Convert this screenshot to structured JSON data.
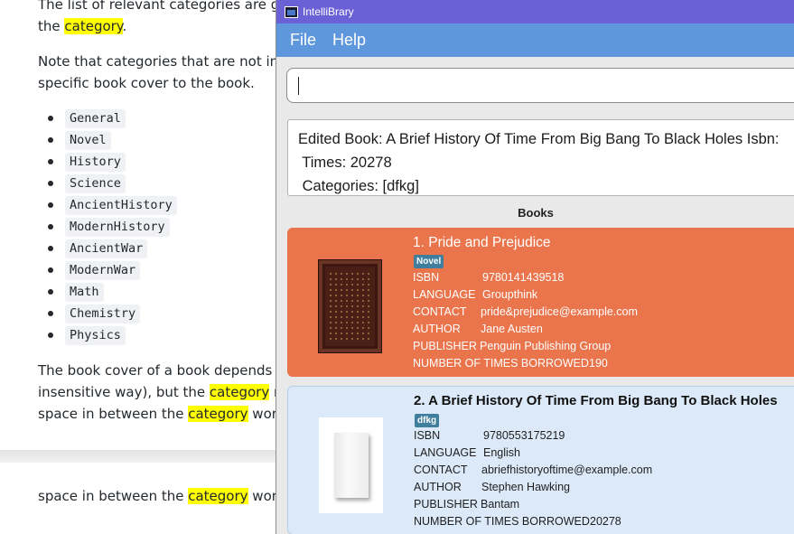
{
  "document": {
    "line1": {
      "before": "The list of relevant categories are give",
      "highlight": "",
      "after": ""
    },
    "line2": {
      "before": "the ",
      "highlight": "category",
      "after": "."
    },
    "note_line1": "Note that categories that are not in th",
    "note_line2": "specific book cover to the book.",
    "categories": [
      "General",
      "Novel",
      "History",
      "Science",
      "AncientHistory",
      "ModernHistory",
      "AncientWar",
      "ModernWar",
      "Math",
      "Chemistry",
      "Physics"
    ],
    "para_line1": "The book cover of a book depends o",
    "para_line2": {
      "before": "insensitive way), but the ",
      "highlight": "category",
      "after": " nar"
    },
    "para_line3": {
      "before": "space in between the ",
      "highlight": "category",
      "after": " words"
    },
    "lower_line": {
      "before": "space in between the ",
      "highlight": "category",
      "after": " words"
    }
  },
  "window": {
    "title": "IntelliBrary",
    "menu": [
      "File",
      "Help"
    ]
  },
  "command_box": {
    "value": ""
  },
  "result_box": {
    "text": "Edited Book: A Brief History Of Time From Big Bang To Black Holes Isbn:\n Times: 20278\n Categories: [dfkg]"
  },
  "book_list": {
    "title": "Books",
    "books": [
      {
        "title": "1.  Pride and Prejudice",
        "tag": "Novel",
        "fields": [
          {
            "label": "ISBN",
            "value": "9780141439518"
          },
          {
            "label": "LANGUAGE",
            "value": "Groupthink"
          },
          {
            "label": "CONTACT",
            "value": "pride&prejudice@example.com"
          },
          {
            "label": "AUTHOR",
            "value": "Jane Austen"
          },
          {
            "label": "PUBLISHER",
            "value": "Penguin Publishing Group"
          },
          {
            "label": "NUMBER OF TIMES BORROWED",
            "value": "190"
          }
        ],
        "color": "#ea744b"
      },
      {
        "title": "2.  A Brief History Of Time From Big Bang To Black Holes",
        "tag": "dfkg",
        "fields": [
          {
            "label": "ISBN",
            "value": "9780553175219"
          },
          {
            "label": "LANGUAGE",
            "value": "English"
          },
          {
            "label": "CONTACT",
            "value": "abriefhistoryoftime@example.com"
          },
          {
            "label": "AUTHOR",
            "value": "Stephen Hawking"
          },
          {
            "label": "PUBLISHER",
            "value": "Bantam"
          },
          {
            "label": "NUMBER OF TIMES BORROWED",
            "value": "20278"
          }
        ],
        "color": "#dbe9f8"
      }
    ]
  },
  "colors": {
    "titlebar": "#6b61d6",
    "menubar": "#5e97dc",
    "highlight": "#ffff00"
  }
}
